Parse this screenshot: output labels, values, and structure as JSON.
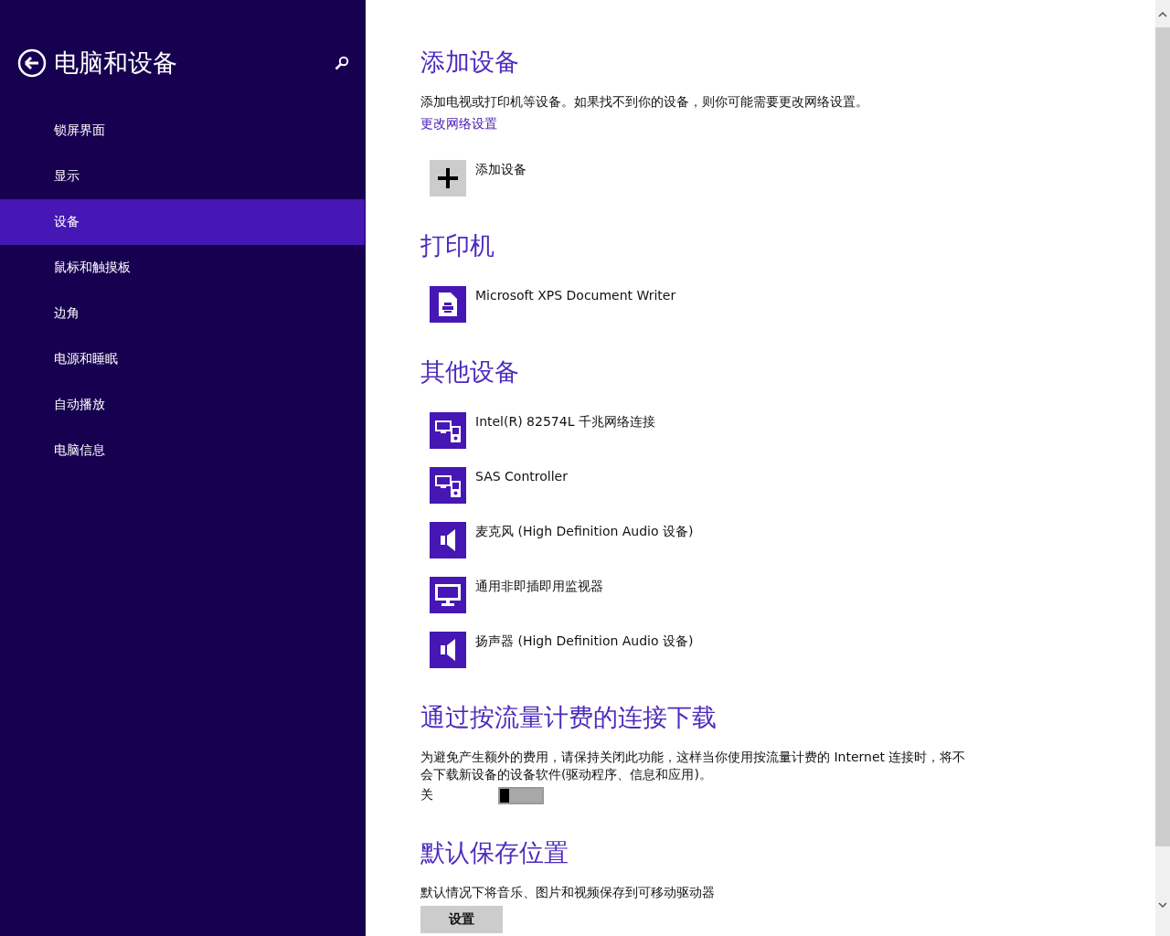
{
  "sidebar": {
    "title": "电脑和设备",
    "items": [
      {
        "label": "锁屏界面",
        "selected": false
      },
      {
        "label": "显示",
        "selected": false
      },
      {
        "label": "设备",
        "selected": true
      },
      {
        "label": "鼠标和触摸板",
        "selected": false
      },
      {
        "label": "边角",
        "selected": false
      },
      {
        "label": "电源和睡眠",
        "selected": false
      },
      {
        "label": "自动播放",
        "selected": false
      },
      {
        "label": "电脑信息",
        "selected": false
      }
    ]
  },
  "sections": [
    {
      "heading": "添加设备",
      "description": "添加电视或打印机等设备。如果找不到你的设备，则你可能需要更改网络设置。",
      "link": "更改网络设置",
      "devices": [
        {
          "kind": "add",
          "name": "添加设备"
        }
      ]
    },
    {
      "heading": "打印机",
      "devices": [
        {
          "kind": "printer",
          "name": "Microsoft XPS Document Writer"
        }
      ]
    },
    {
      "heading": "其他设备",
      "devices": [
        {
          "kind": "devices",
          "name": "Intel(R) 82574L 千兆网络连接"
        },
        {
          "kind": "devices",
          "name": "SAS Controller"
        },
        {
          "kind": "speaker",
          "name": "麦克风 (High Definition Audio 设备)"
        },
        {
          "kind": "monitor",
          "name": "通用非即插即用监视器"
        },
        {
          "kind": "speaker",
          "name": "扬声器 (High Definition Audio 设备)"
        }
      ]
    },
    {
      "heading": "通过按流量计费的连接下载",
      "description": "为避免产生额外的费用，请保持关闭此功能，这样当你使用按流量计费的 Internet 连接时，将不会下载新设备的设备软件(驱动程序、信息和应用)。",
      "toggle": {
        "label": "关",
        "on": false
      }
    },
    {
      "heading": "默认保存位置",
      "description": "默认情况下将音乐、图片和视频保存到可移动驱动器",
      "button": "设置"
    }
  ]
}
